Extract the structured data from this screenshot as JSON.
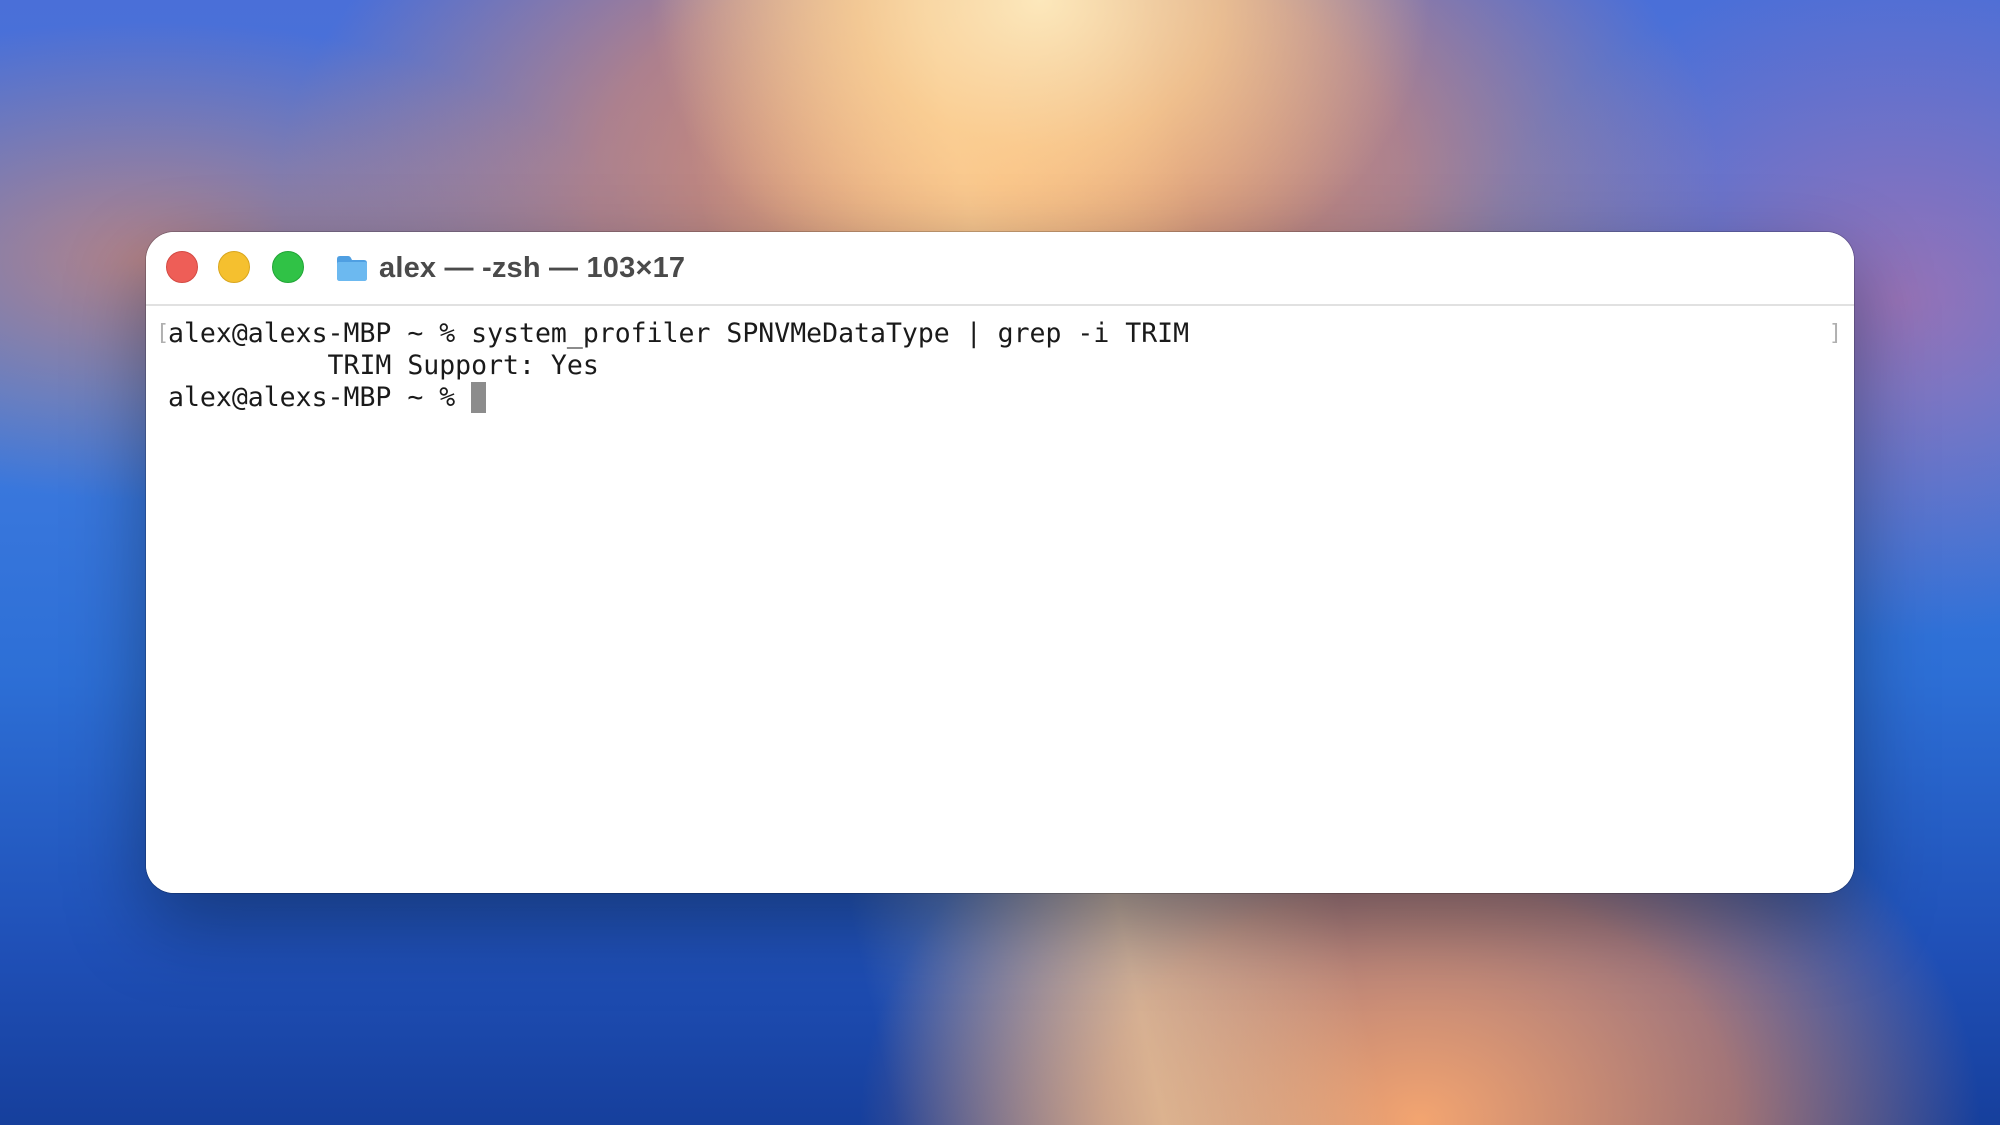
{
  "window": {
    "title": "alex — -zsh — 103×17",
    "folder_icon": "folder-icon",
    "controls": {
      "close": "close-button",
      "minimize": "minimize-button",
      "zoom": "zoom-button"
    }
  },
  "terminal": {
    "lines": [
      "alex@alexs-MBP ~ % system_profiler SPNVMeDataType | grep -i TRIM",
      "          TRIM Support: Yes",
      "alex@alexs-MBP ~ % "
    ],
    "bracket_left": "[",
    "bracket_right": "]"
  },
  "colors": {
    "close": "#ee5e57",
    "minimize": "#f5c02f",
    "zoom": "#30c246",
    "cursor": "#8c8c8c",
    "folder": "#5aa9e6"
  }
}
